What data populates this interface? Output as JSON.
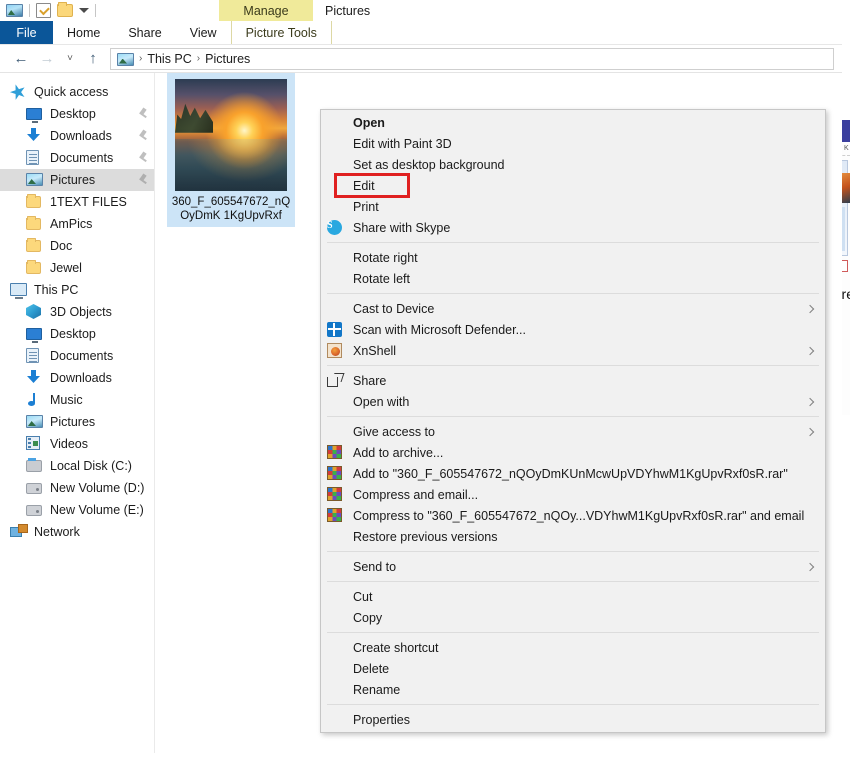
{
  "window": {
    "title": "Pictures",
    "contextual_tab_group": "Manage",
    "contextual_tab": "Picture Tools"
  },
  "quick_access_toolbar": {
    "items": [
      {
        "name": "pictures-icon",
        "label": "Pictures"
      },
      {
        "name": "properties-icon",
        "label": "Properties"
      },
      {
        "name": "new-folder-icon",
        "label": "New folder"
      },
      {
        "name": "customize-caret",
        "label": "Customize Quick Access Toolbar"
      }
    ]
  },
  "ribbon": {
    "tabs": [
      {
        "label": "File",
        "selected": true
      },
      {
        "label": "Home",
        "selected": false
      },
      {
        "label": "Share",
        "selected": false
      },
      {
        "label": "View",
        "selected": false
      }
    ],
    "picture_tools_tab": "Picture Tools"
  },
  "address_bar": {
    "back": "←",
    "forward": "→",
    "recent": "˅",
    "up": "↑",
    "breadcrumbs": [
      "This PC",
      "Pictures"
    ],
    "separator": "›"
  },
  "sidebar": {
    "items": [
      {
        "label": "Quick access",
        "icon": "star-icon",
        "indent": 0,
        "pinned": false,
        "selected": false
      },
      {
        "label": "Desktop",
        "icon": "monitor-icon",
        "indent": 1,
        "pinned": true,
        "selected": false
      },
      {
        "label": "Downloads",
        "icon": "download-icon",
        "indent": 1,
        "pinned": true,
        "selected": false
      },
      {
        "label": "Documents",
        "icon": "document-icon",
        "indent": 1,
        "pinned": true,
        "selected": false
      },
      {
        "label": "Pictures",
        "icon": "pictures-icon",
        "indent": 1,
        "pinned": true,
        "selected": true
      },
      {
        "label": "1TEXT FILES",
        "icon": "folder-icon",
        "indent": 1,
        "pinned": false,
        "selected": false
      },
      {
        "label": "AmPics",
        "icon": "folder-icon",
        "indent": 1,
        "pinned": false,
        "selected": false
      },
      {
        "label": "Doc",
        "icon": "folder-icon",
        "indent": 1,
        "pinned": false,
        "selected": false
      },
      {
        "label": "Jewel",
        "icon": "folder-icon",
        "indent": 1,
        "pinned": false,
        "selected": false
      },
      {
        "label": "This PC",
        "icon": "pc-icon",
        "indent": 0,
        "pinned": false,
        "selected": false
      },
      {
        "label": "3D Objects",
        "icon": "3d-objects-icon",
        "indent": 1,
        "pinned": false,
        "selected": false
      },
      {
        "label": "Desktop",
        "icon": "monitor-icon",
        "indent": 1,
        "pinned": false,
        "selected": false
      },
      {
        "label": "Documents",
        "icon": "document-icon",
        "indent": 1,
        "pinned": false,
        "selected": false
      },
      {
        "label": "Downloads",
        "icon": "download-icon",
        "indent": 1,
        "pinned": false,
        "selected": false
      },
      {
        "label": "Music",
        "icon": "music-icon",
        "indent": 1,
        "pinned": false,
        "selected": false
      },
      {
        "label": "Pictures",
        "icon": "pictures-icon",
        "indent": 1,
        "pinned": false,
        "selected": false
      },
      {
        "label": "Videos",
        "icon": "video-icon",
        "indent": 1,
        "pinned": false,
        "selected": false
      },
      {
        "label": "Local Disk (C:)",
        "icon": "local-disk-icon",
        "indent": 1,
        "pinned": false,
        "selected": false
      },
      {
        "label": "New Volume (D:)",
        "icon": "disk-icon",
        "indent": 1,
        "pinned": false,
        "selected": false
      },
      {
        "label": "New Volume (E:)",
        "icon": "disk-icon",
        "indent": 1,
        "pinned": false,
        "selected": false
      },
      {
        "label": "Network",
        "icon": "network-icon",
        "indent": 0,
        "pinned": false,
        "selected": false
      }
    ]
  },
  "file_area": {
    "selected_file": {
      "name_line1": "360_F_605547672_nQOyDmK",
      "name_line2": "1KgUpvRxf",
      "thumbnail": "sunset-lake-landscape"
    }
  },
  "context_menu": {
    "highlighted_item": "Edit",
    "highlight_color": "#e02020",
    "groups": [
      {
        "items": [
          {
            "label": "Open",
            "icon": null,
            "bold": true,
            "submenu": false
          },
          {
            "label": "Edit with Paint 3D",
            "icon": null,
            "bold": false,
            "submenu": false
          },
          {
            "label": "Set as desktop background",
            "icon": null,
            "bold": false,
            "submenu": false
          },
          {
            "label": "Edit",
            "icon": null,
            "bold": false,
            "submenu": false
          },
          {
            "label": "Print",
            "icon": null,
            "bold": false,
            "submenu": false
          },
          {
            "label": "Share with Skype",
            "icon": "skype-icon",
            "bold": false,
            "submenu": false
          }
        ]
      },
      {
        "items": [
          {
            "label": "Rotate right",
            "icon": null,
            "bold": false,
            "submenu": false
          },
          {
            "label": "Rotate left",
            "icon": null,
            "bold": false,
            "submenu": false
          }
        ]
      },
      {
        "items": [
          {
            "label": "Cast to Device",
            "icon": null,
            "bold": false,
            "submenu": true
          },
          {
            "label": "Scan with Microsoft Defender...",
            "icon": "defender-icon",
            "bold": false,
            "submenu": false
          },
          {
            "label": "XnShell",
            "icon": "xnshell-icon",
            "bold": false,
            "submenu": true
          }
        ]
      },
      {
        "items": [
          {
            "label": "Share",
            "icon": "share-icon",
            "bold": false,
            "submenu": false
          },
          {
            "label": "Open with",
            "icon": null,
            "bold": false,
            "submenu": true
          }
        ]
      },
      {
        "items": [
          {
            "label": "Give access to",
            "icon": null,
            "bold": false,
            "submenu": true
          },
          {
            "label": "Add to archive...",
            "icon": "winrar-icon",
            "bold": false,
            "submenu": false
          },
          {
            "label": "Add to \"360_F_605547672_nQOyDmKUnMcwUpVDYhwM1KgUpvRxf0sR.rar\"",
            "icon": "winrar-icon",
            "bold": false,
            "submenu": false
          },
          {
            "label": "Compress and email...",
            "icon": "winrar-icon",
            "bold": false,
            "submenu": false
          },
          {
            "label": "Compress to \"360_F_605547672_nQOy...VDYhwM1KgUpvRxf0sR.rar\" and email",
            "icon": "winrar-icon",
            "bold": false,
            "submenu": false
          },
          {
            "label": "Restore previous versions",
            "icon": null,
            "bold": false,
            "submenu": false
          }
        ]
      },
      {
        "items": [
          {
            "label": "Send to",
            "icon": null,
            "bold": false,
            "submenu": true
          }
        ]
      },
      {
        "items": [
          {
            "label": "Cut",
            "icon": null,
            "bold": false,
            "submenu": false
          },
          {
            "label": "Copy",
            "icon": null,
            "bold": false,
            "submenu": false
          }
        ]
      },
      {
        "items": [
          {
            "label": "Create shortcut",
            "icon": null,
            "bold": false,
            "submenu": false
          },
          {
            "label": "Delete",
            "icon": null,
            "bold": false,
            "submenu": false
          },
          {
            "label": "Rename",
            "icon": null,
            "bold": false,
            "submenu": false
          }
        ]
      },
      {
        "items": [
          {
            "label": "Properties",
            "icon": null,
            "bold": false,
            "submenu": false
          }
        ]
      }
    ]
  },
  "background_window": {
    "column_header": "Size in K",
    "note_text": "-incre"
  }
}
